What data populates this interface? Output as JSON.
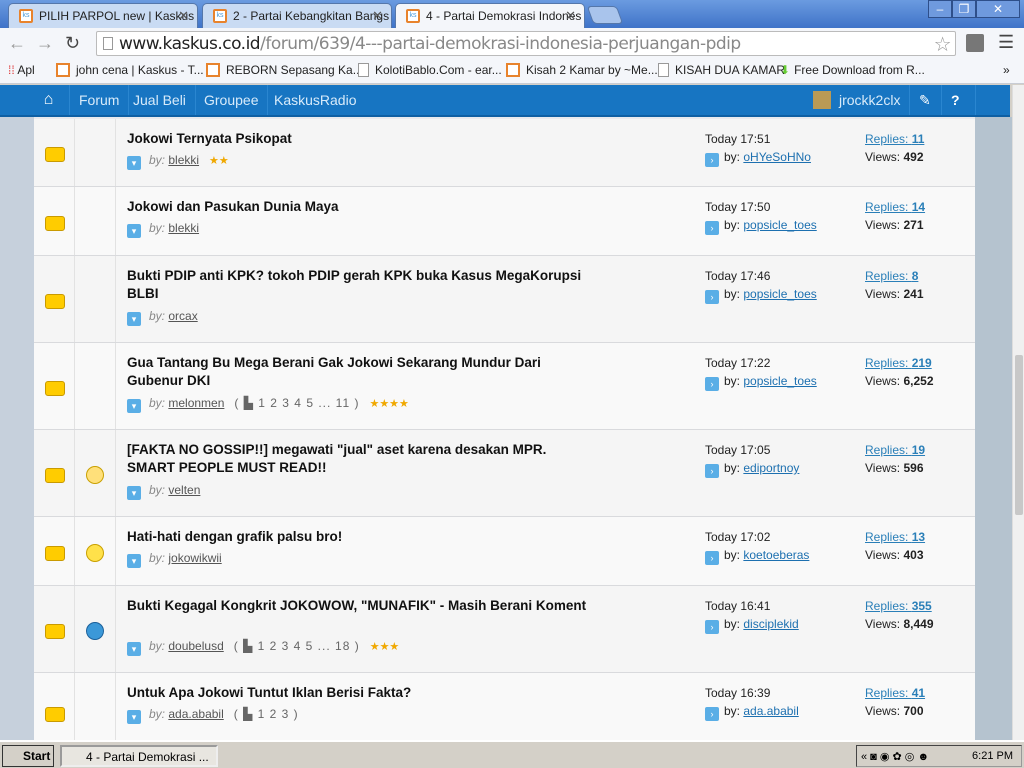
{
  "browser": {
    "tabs": [
      {
        "label": "PILIH PARPOL new | Kaskus"
      },
      {
        "label": "2 - Partai Kebangkitan Bangs"
      },
      {
        "label": "4 - Partai Demokrasi Indones"
      }
    ],
    "url_host": "www.kaskus.co.id",
    "url_path": "/forum/639/4---partai-demokrasi-indonesia-perjuangan-pdip",
    "bookmarks": [
      {
        "label": "Apl"
      },
      {
        "label": "john cena | Kaskus - T..."
      },
      {
        "label": "REBORN Sepasang Ka..."
      },
      {
        "label": "KolotiBablo.Com - ear..."
      },
      {
        "label": "Kisah 2 Kamar by ~Me..."
      },
      {
        "label": "KISAH DUA KAMAR"
      },
      {
        "label": "Free Download from R..."
      }
    ],
    "more": "»"
  },
  "nav": {
    "items": [
      "Forum",
      "Jual Beli",
      "Groupee",
      "KaskusRadio"
    ],
    "username": "jrockk2clx"
  },
  "threads": [
    {
      "title": "Jokowi Ternyata Psikopat",
      "author": "blekki",
      "pages": "",
      "stars": "★★",
      "emoticon": "",
      "last_time": "Today 17:51",
      "last_by": "oHYeSoHNo",
      "replies": "11",
      "views": "492"
    },
    {
      "title": "Jokowi dan Pasukan Dunia Maya",
      "author": "blekki",
      "pages": "",
      "stars": "",
      "emoticon": "",
      "last_time": "Today 17:50",
      "last_by": "popsicle_toes",
      "replies": "14",
      "views": "271"
    },
    {
      "title": "Bukti PDIP anti KPK? tokoh PDIP gerah KPK buka Kasus MegaKorupsi BLBI",
      "author": "orcax",
      "pages": "",
      "stars": "",
      "emoticon": "",
      "last_time": "Today 17:46",
      "last_by": "popsicle_toes",
      "replies": "8",
      "views": "241"
    },
    {
      "title": "Gua Tantang Bu Mega Berani Gak Jokowi Sekarang Mundur Dari Gubenur DKI",
      "author": "melonmen",
      "pages": "( ▙ 1  2  3  4  5 ... 11 )",
      "stars": "★★★★",
      "emoticon": "",
      "last_time": "Today 17:22",
      "last_by": "popsicle_toes",
      "replies": "219",
      "views": "6,252"
    },
    {
      "title": "[FAKTA NO GOSSIP!!] megawati \"jual\" aset karena desakan MPR. SMART PEOPLE MUST READ!!",
      "author": "velten",
      "pages": "",
      "stars": "",
      "emoticon": "lightbulb",
      "last_time": "Today 17:05",
      "last_by": "ediportnoy",
      "replies": "19",
      "views": "596"
    },
    {
      "title": "Hati-hati dengan grafik palsu bro!",
      "author": "jokowikwii",
      "pages": "",
      "stars": "",
      "emoticon": "smile",
      "last_time": "Today 17:02",
      "last_by": "koetoeberas",
      "replies": "13",
      "views": "403"
    },
    {
      "title": "Bukti Kegagal Kongkrit JOKOWOW, \"MUNAFIK\" - Masih Berani Koment",
      "author": "doubelusd",
      "pages": "( ▙ 1  2  3  4  5 ... 18 )",
      "stars": "★★★",
      "emoticon": "cool",
      "last_time": "Today 16:41",
      "last_by": "disciplekid",
      "replies": "355",
      "views": "8,449"
    },
    {
      "title": "Untuk Apa Jokowi Tuntut Iklan Berisi Fakta?",
      "author": "ada.ababil",
      "pages": "( ▙ 1  2  3 )",
      "stars": "",
      "emoticon": "",
      "last_time": "Today 16:39",
      "last_by": "ada.ababil",
      "replies": "41",
      "views": "700"
    }
  ],
  "labels": {
    "by": "by:",
    "replies": "Replies: ",
    "views": "Views: "
  },
  "taskbar": {
    "start": "Start",
    "task": "4 - Partai Demokrasi ...",
    "clock": "6:21 PM"
  }
}
